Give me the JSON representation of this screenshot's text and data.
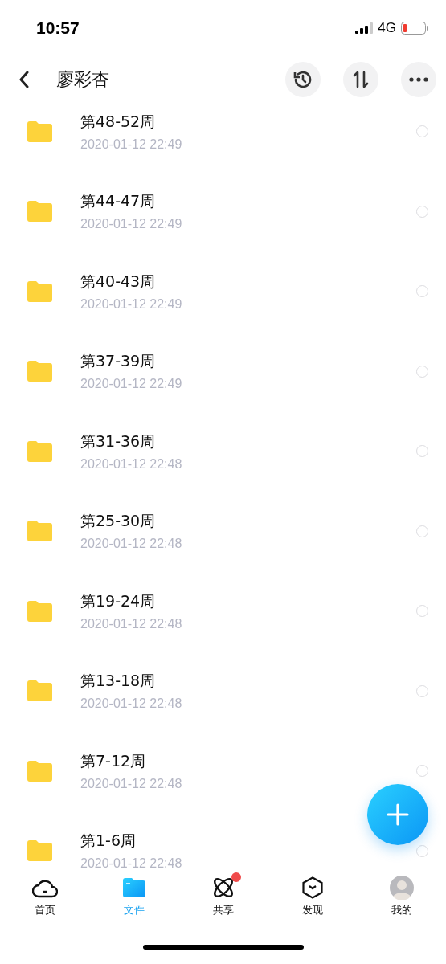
{
  "status_bar": {
    "time": "10:57",
    "network": "4G"
  },
  "header": {
    "title": "廖彩杏"
  },
  "files": [
    {
      "name": "第48-52周",
      "date": "2020-01-12 22:49",
      "selected": false
    },
    {
      "name": "第44-47周",
      "date": "2020-01-12 22:49",
      "selected": false
    },
    {
      "name": "第40-43周",
      "date": "2020-01-12 22:49",
      "selected": false
    },
    {
      "name": "第37-39周",
      "date": "2020-01-12 22:49",
      "selected": false
    },
    {
      "name": "第31-36周",
      "date": "2020-01-12 22:48",
      "selected": false
    },
    {
      "name": "第25-30周",
      "date": "2020-01-12 22:48",
      "selected": false
    },
    {
      "name": "第19-24周",
      "date": "2020-01-12 22:48",
      "selected": false
    },
    {
      "name": "第13-18周",
      "date": "2020-01-12 22:48",
      "selected": false
    },
    {
      "name": "第7-12周",
      "date": "2020-01-12 22:48",
      "selected": false
    },
    {
      "name": "第1-6周",
      "date": "2020-01-12 22:48",
      "selected": false
    }
  ],
  "tabs": [
    {
      "kind": "home",
      "label": "首页",
      "selected": false,
      "dot": false
    },
    {
      "kind": "files",
      "label": "文件",
      "selected": true,
      "dot": false
    },
    {
      "kind": "share",
      "label": "共享",
      "selected": false,
      "dot": true
    },
    {
      "kind": "discover",
      "label": "发现",
      "selected": false,
      "dot": false
    },
    {
      "kind": "me",
      "label": "我的",
      "selected": false,
      "dot": false
    }
  ]
}
